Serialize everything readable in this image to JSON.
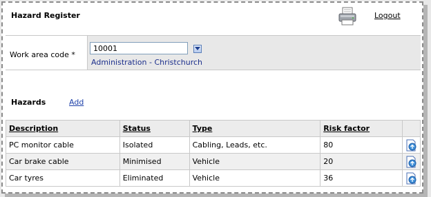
{
  "header": {
    "title": "Hazard Register",
    "print_icon": "printer-icon",
    "logout_label": "Logout"
  },
  "filter": {
    "label": "Work area code *",
    "code_value": "10001",
    "dropdown_icon": "chevron-down-icon",
    "area_name": "Administration - Christchurch"
  },
  "hazards": {
    "title": "Hazards",
    "add_label": "Add",
    "columns": [
      "Description",
      "Status",
      "Type",
      "Risk factor"
    ],
    "rows": [
      {
        "description": "PC monitor cable",
        "status": "Isolated",
        "type": "Cabling, Leads, etc.",
        "risk": "80",
        "icon": "edit-document-icon"
      },
      {
        "description": "Car brake cable",
        "status": "Minimised",
        "type": "Vehicle",
        "risk": "20",
        "icon": "edit-document-icon"
      },
      {
        "description": "Car tyres",
        "status": "Eliminated",
        "type": "Vehicle",
        "risk": "36",
        "icon": "edit-document-icon"
      }
    ]
  },
  "colors": {
    "link": "#1c3fa8",
    "area_text": "#1c2f8c",
    "filter_bg": "#e8e8e8",
    "grid_border": "#c8c8c8"
  }
}
